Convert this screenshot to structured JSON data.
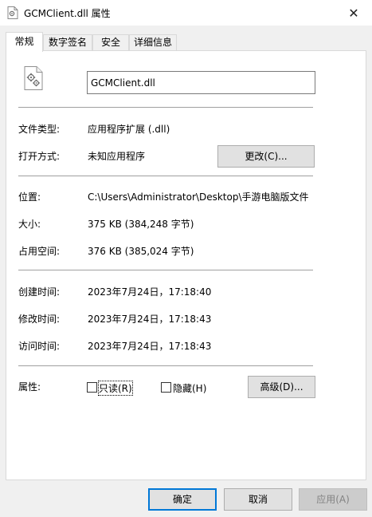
{
  "window": {
    "title": "GCMClient.dll 属性",
    "close_glyph": "✕"
  },
  "tabs": [
    {
      "label": "常规",
      "active": true
    },
    {
      "label": "数字签名",
      "active": false
    },
    {
      "label": "安全",
      "active": false
    },
    {
      "label": "详细信息",
      "active": false
    }
  ],
  "general": {
    "file_name": "GCMClient.dll",
    "type_label": "文件类型:",
    "type_value": "应用程序扩展 (.dll)",
    "open_with_label": "打开方式:",
    "open_with_value": "未知应用程序",
    "change_button": "更改(C)...",
    "location_label": "位置:",
    "location_value": "C:\\Users\\Administrator\\Desktop\\手游电脑版文件",
    "size_label": "大小:",
    "size_value": "375 KB (384,248 字节)",
    "size_on_disk_label": "占用空间:",
    "size_on_disk_value": "376 KB (385,024 字节)",
    "created_label": "创建时间:",
    "created_value": "2023年7月24日，17:18:40",
    "modified_label": "修改时间:",
    "modified_value": "2023年7月24日，17:18:43",
    "accessed_label": "访问时间:",
    "accessed_value": "2023年7月24日，17:18:43",
    "attributes_label": "属性:",
    "readonly_label": "只读(R)",
    "readonly_checked": false,
    "hidden_label": "隐藏(H)",
    "hidden_checked": false,
    "advanced_button": "高级(D)..."
  },
  "footer": {
    "ok_button": "确定",
    "cancel_button": "取消",
    "apply_button": "应用(A)"
  },
  "colors": {
    "focus_accent": "#0078d7",
    "window_background": "#f0f0f0",
    "panel_background": "#ffffff"
  }
}
